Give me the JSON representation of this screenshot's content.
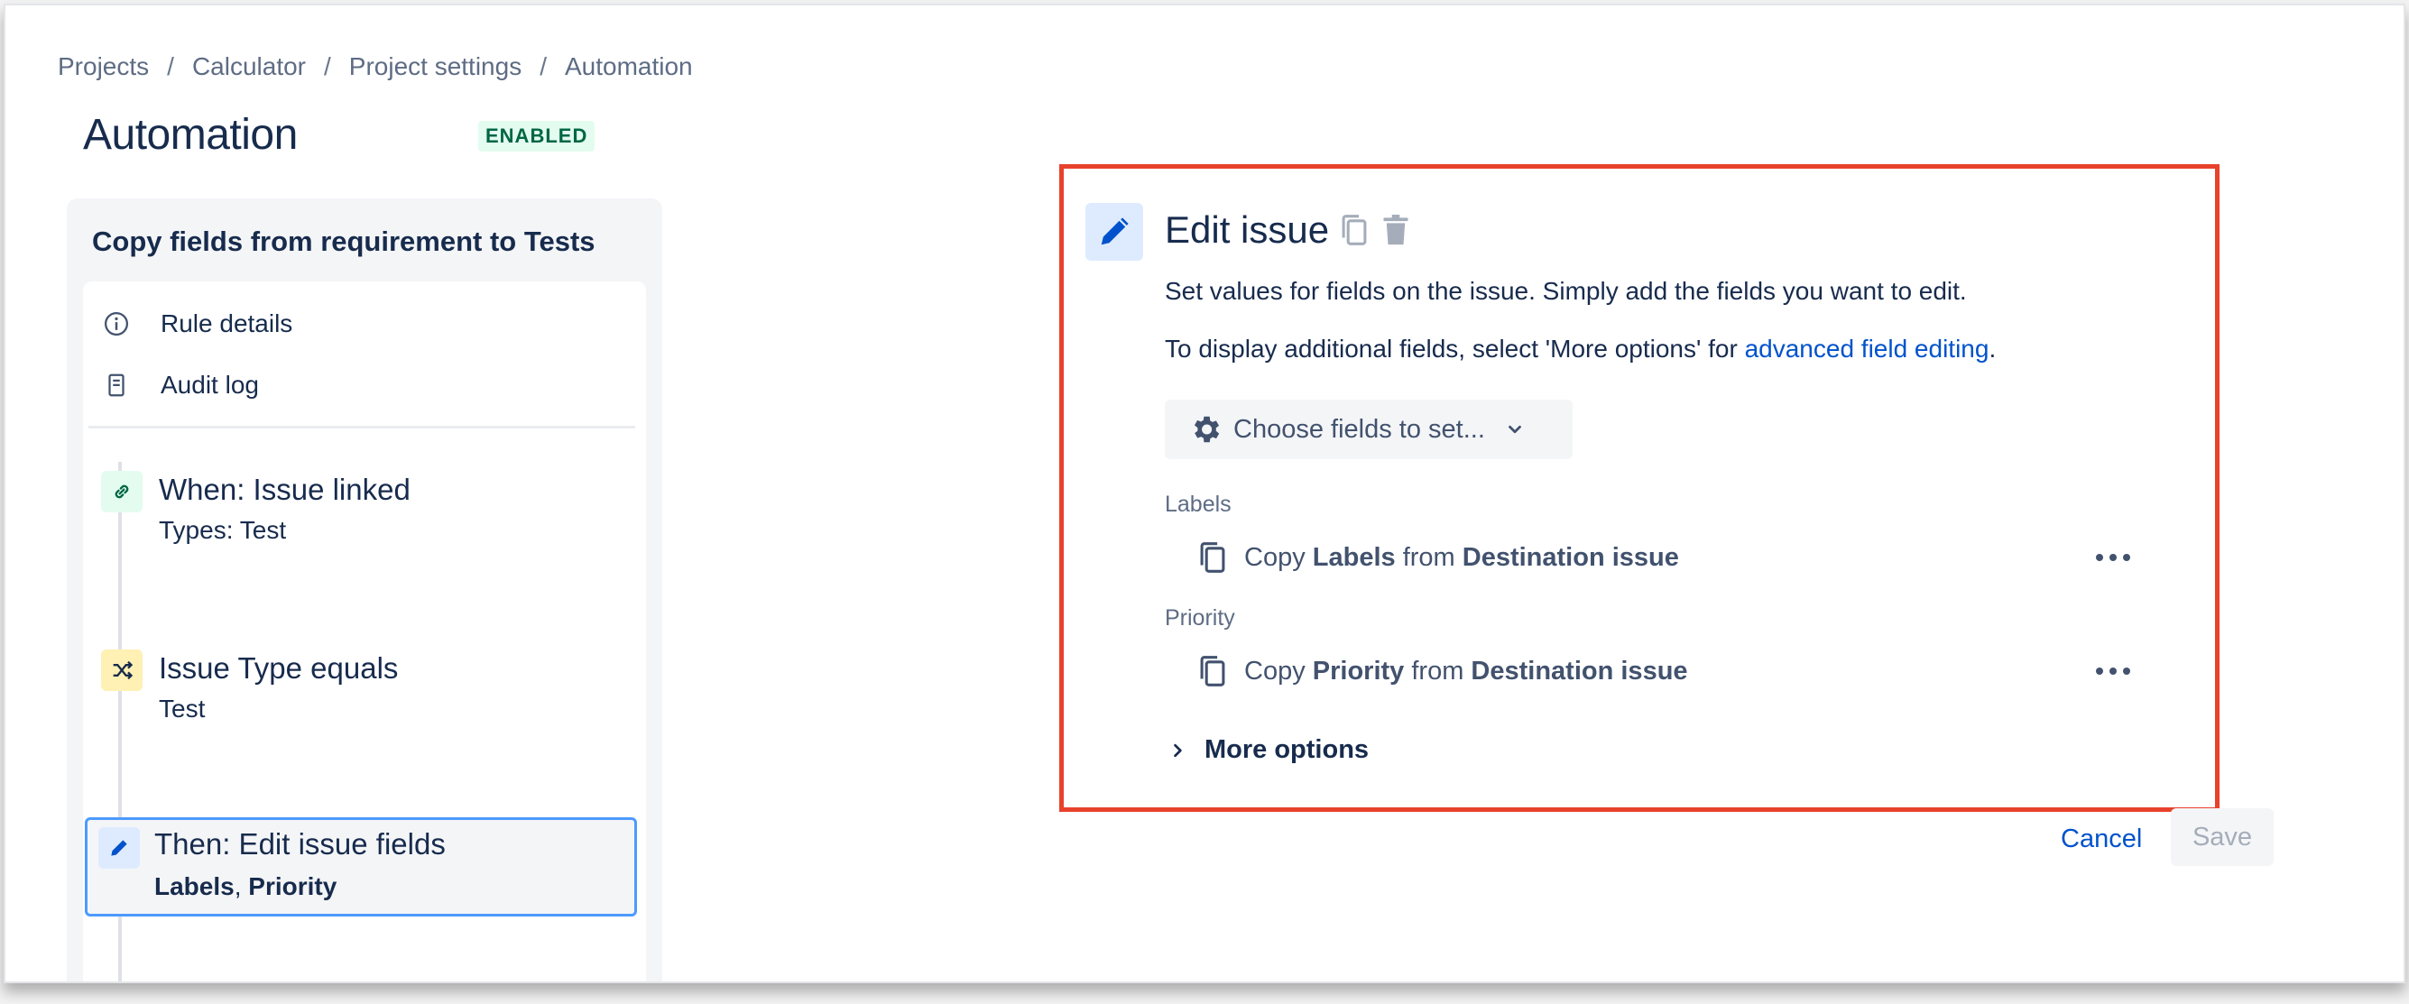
{
  "breadcrumb": {
    "items": [
      "Projects",
      "Calculator",
      "Project settings",
      "Automation"
    ],
    "separator": "/"
  },
  "page": {
    "title": "Automation",
    "status": "ENABLED"
  },
  "rule": {
    "name": "Copy fields from requirement to Tests",
    "nav": [
      {
        "label": "Rule details",
        "icon": "info-icon"
      },
      {
        "label": "Audit log",
        "icon": "document-icon"
      }
    ],
    "steps": [
      {
        "title": "When: Issue linked",
        "subtitle": "Types: Test",
        "icon": "link-icon",
        "color": "#e3fcef"
      },
      {
        "title": "Issue Type equals",
        "subtitle": "Test",
        "icon": "shuffle-icon",
        "color": "#fff0b3"
      },
      {
        "title": "Then: Edit issue fields",
        "subtitle_parts": [
          "Labels",
          ", ",
          "Priority"
        ],
        "icon": "pencil-icon",
        "color": "#deebff"
      }
    ]
  },
  "editor": {
    "title": "Edit issue",
    "description": "Set values for fields on the issue. Simply add the fields you want to edit.",
    "more_info_prefix": "To display additional fields, select 'More options' for ",
    "more_info_link": "advanced field editing",
    "more_info_suffix": ".",
    "choose_fields_label": "Choose fields to set...",
    "fields": [
      {
        "label": "Labels",
        "prefix": "Copy ",
        "field": "Labels",
        "middle": " from ",
        "source": "Destination issue"
      },
      {
        "label": "Priority",
        "prefix": "Copy ",
        "field": "Priority",
        "middle": " from ",
        "source": "Destination issue"
      }
    ],
    "more_options_label": "More options"
  },
  "actions": {
    "cancel_label": "Cancel",
    "save_label": "Save"
  },
  "colors": {
    "accent": "#0052cc",
    "highlight_border": "#e8412c",
    "selected_border": "#4c9aff",
    "enabled_badge_bg": "#e3fcef",
    "enabled_badge_text": "#006644"
  }
}
